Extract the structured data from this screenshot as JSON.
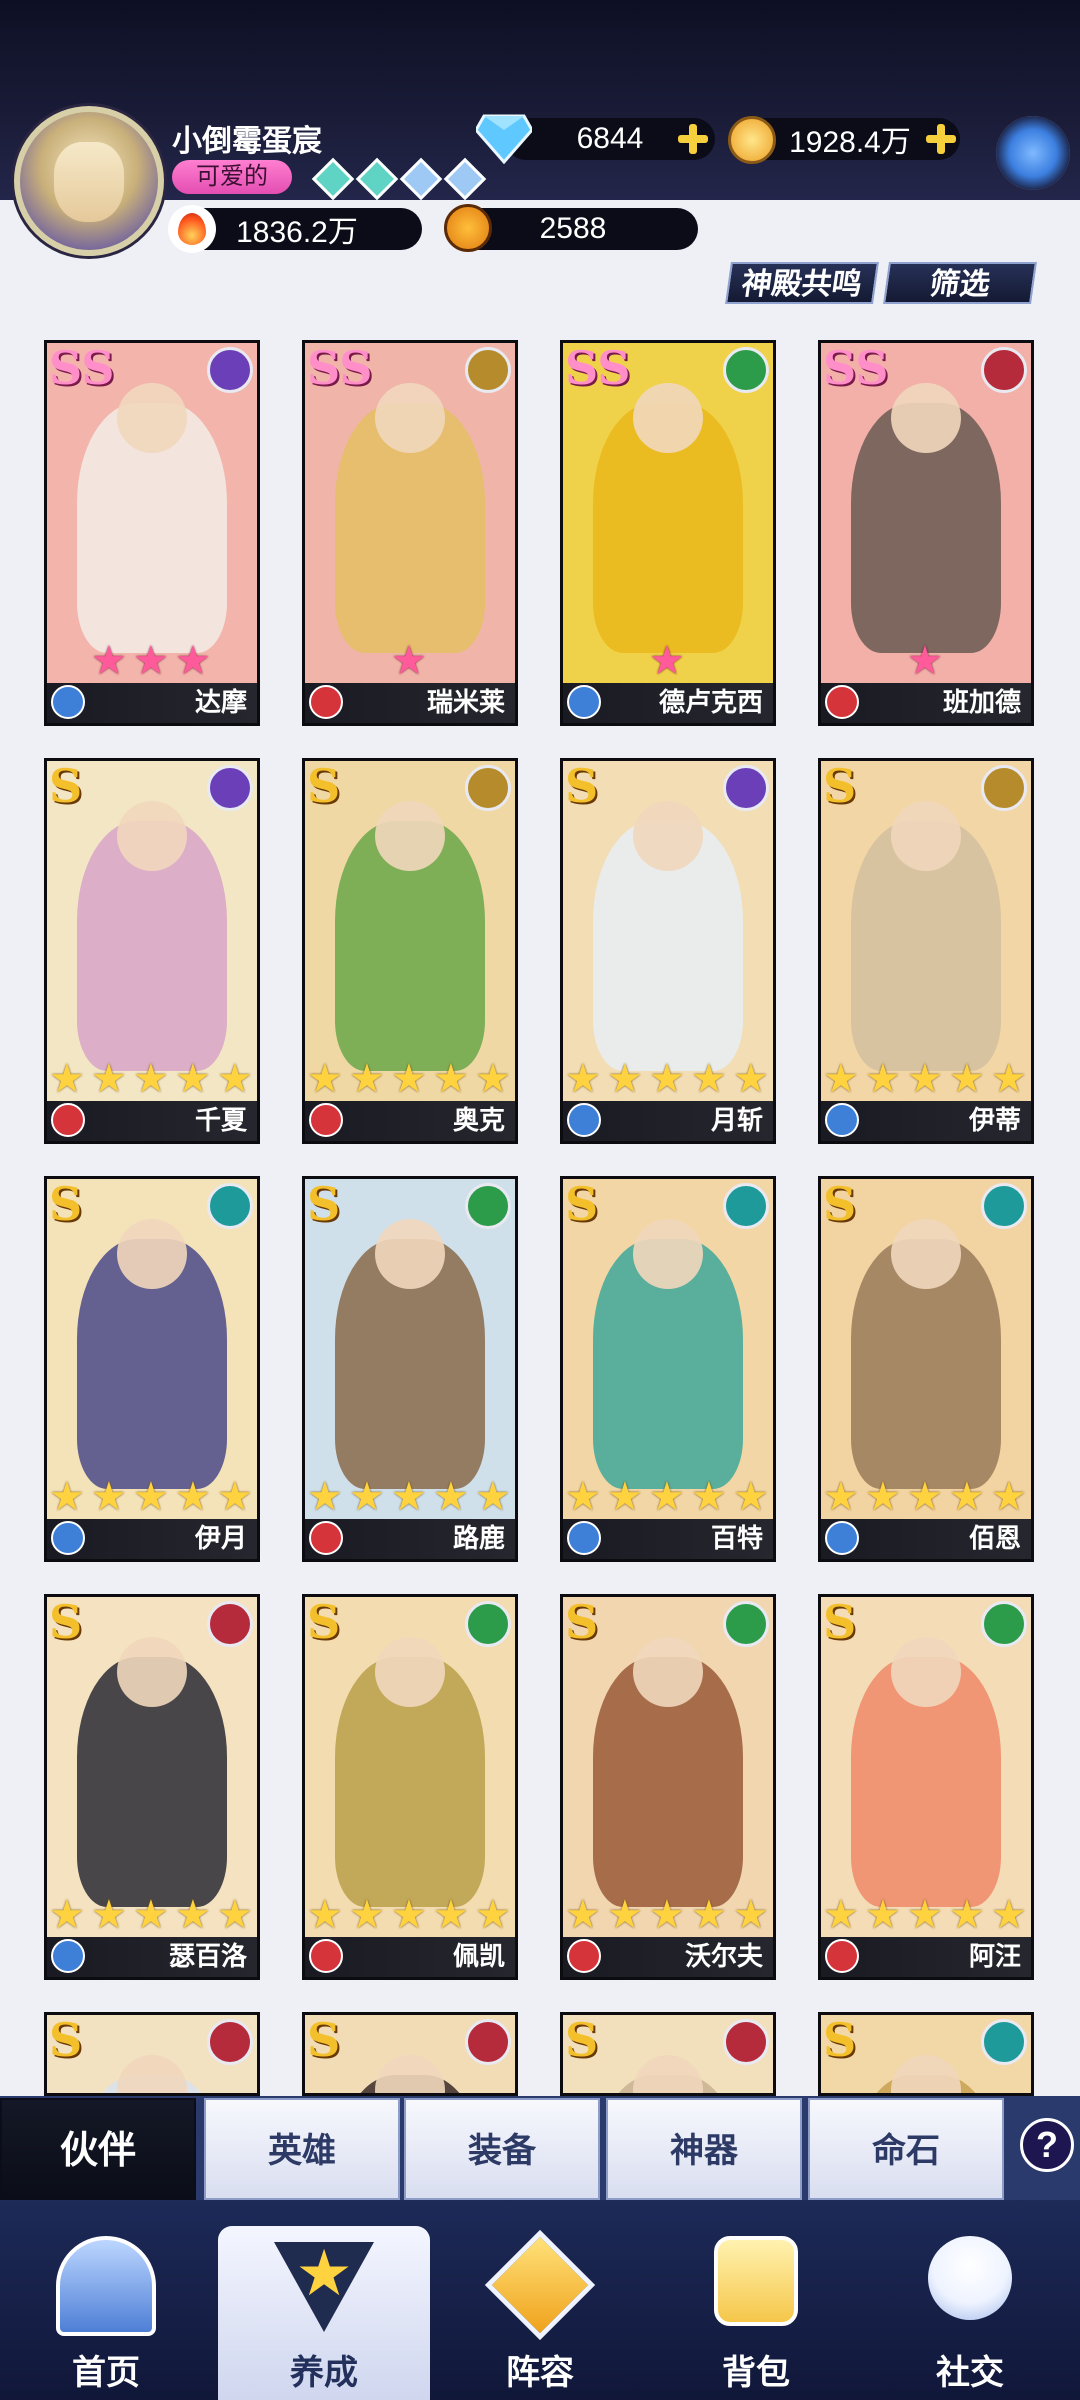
{
  "player": {
    "name": "小倒霉蛋宸",
    "title": "可爱的",
    "diamonds": "6844",
    "gold": "1928.4万",
    "power": "1836.2万",
    "star_coins": "2588"
  },
  "filters": {
    "resonance_label": "神殿共鸣",
    "filter_label": "筛选"
  },
  "cards": [
    {
      "name": "达摩",
      "rank": "SS",
      "stars": 3,
      "star_color": "pink",
      "faction_color": "#6b3fb8",
      "role_color": "#3e7fd8",
      "bg": "#f3b4ab",
      "figure": "#f2ede6"
    },
    {
      "name": "瑞米莱",
      "rank": "SS",
      "stars": 1,
      "star_color": "pink",
      "faction_color": "#b58b2c",
      "role_color": "#d6343b",
      "bg": "#f0b5a8",
      "figure": "#e4c063"
    },
    {
      "name": "德卢克西",
      "rank": "SS",
      "stars": 1,
      "star_color": "pink",
      "faction_color": "#2c9c4a",
      "role_color": "#3e7fd8",
      "bg": "#f0d24a",
      "figure": "#e9b91a"
    },
    {
      "name": "班加德",
      "rank": "SS",
      "stars": 1,
      "star_color": "pink",
      "faction_color": "#b52b3b",
      "role_color": "#d6343b",
      "bg": "#f2b0a8",
      "figure": "#6a5a52"
    },
    {
      "name": "千夏",
      "rank": "S",
      "stars": 5,
      "star_color": "gold",
      "faction_color": "#6b3fb8",
      "role_color": "#d6343b",
      "bg": "#f3e6c4",
      "figure": "#d7a3c8"
    },
    {
      "name": "奥克",
      "rank": "S",
      "stars": 5,
      "star_color": "gold",
      "faction_color": "#b58b2c",
      "role_color": "#d6343b",
      "bg": "#f0d8a4",
      "figure": "#6aa84a"
    },
    {
      "name": "月斩",
      "rank": "S",
      "stars": 5,
      "star_color": "gold",
      "faction_color": "#6b3fb8",
      "role_color": "#3e7fd8",
      "bg": "#f3ddb4",
      "figure": "#e8eef6"
    },
    {
      "name": "伊蒂",
      "rank": "S",
      "stars": 5,
      "star_color": "gold",
      "faction_color": "#b58b2c",
      "role_color": "#3e7fd8",
      "bg": "#f2d6a6",
      "figure": "#d4c0a0"
    },
    {
      "name": "伊月",
      "rank": "S",
      "stars": 5,
      "star_color": "gold",
      "faction_color": "#1f9a9a",
      "role_color": "#3e7fd8",
      "bg": "#f4e2b8",
      "figure": "#4a4a8a"
    },
    {
      "name": "路鹿",
      "rank": "S",
      "stars": 5,
      "star_color": "gold",
      "faction_color": "#2c9c4a",
      "role_color": "#d6343b",
      "bg": "#cfe0ea",
      "figure": "#8a6a4a"
    },
    {
      "name": "百特",
      "rank": "S",
      "stars": 5,
      "star_color": "gold",
      "faction_color": "#1f9a9a",
      "role_color": "#3e7fd8",
      "bg": "#f2d6a6",
      "figure": "#3ea79a"
    },
    {
      "name": "佰恩",
      "rank": "S",
      "stars": 5,
      "star_color": "gold",
      "faction_color": "#1f9a9a",
      "role_color": "#3e7fd8",
      "bg": "#f2d3a2",
      "figure": "#9a7a5a"
    },
    {
      "name": "瑟百洛",
      "rank": "S",
      "stars": 5,
      "star_color": "gold",
      "faction_color": "#b52b3b",
      "role_color": "#3e7fd8",
      "bg": "#f4e2c0",
      "figure": "#2a2a34"
    },
    {
      "name": "佩凯",
      "rank": "S",
      "stars": 5,
      "star_color": "gold",
      "faction_color": "#2c9c4a",
      "role_color": "#d6343b",
      "bg": "#f3dcb0",
      "figure": "#b8a04a"
    },
    {
      "name": "沃尔夫",
      "rank": "S",
      "stars": 5,
      "star_color": "gold",
      "faction_color": "#2c9c4a",
      "role_color": "#d6343b",
      "bg": "#f1d6b0",
      "figure": "#9a5a3a"
    },
    {
      "name": "阿汪",
      "rank": "S",
      "stars": 5,
      "star_color": "gold",
      "faction_color": "#2c9c4a",
      "role_color": "#d6343b",
      "bg": "#f3dcb6",
      "figure": "#f08a6a"
    },
    {
      "name": "",
      "rank": "S",
      "stars": 0,
      "star_color": "gold",
      "faction_color": "#b52b3b",
      "role_color": "#3e7fd8",
      "bg": "#f2e2c2",
      "figure": "#d8e2ee"
    },
    {
      "name": "",
      "rank": "S",
      "stars": 0,
      "star_color": "gold",
      "faction_color": "#b52b3b",
      "role_color": "#3e7fd8",
      "bg": "#f1dcb6",
      "figure": "#3a2a28"
    },
    {
      "name": "",
      "rank": "S",
      "stars": 0,
      "star_color": "gold",
      "faction_color": "#b52b3b",
      "role_color": "#3e7fd8",
      "bg": "#f2e0bc",
      "figure": "#c8b090"
    },
    {
      "name": "",
      "rank": "S",
      "stars": 0,
      "star_color": "gold",
      "faction_color": "#1f9a9a",
      "role_color": "#3e7fd8",
      "bg": "#f2d8a6",
      "figure": "#c8a050"
    }
  ],
  "subtabs": [
    "伙伴",
    "英雄",
    "装备",
    "神器",
    "命石"
  ],
  "help_label": "?",
  "nav": [
    "首页",
    "养成",
    "阵容",
    "背包",
    "社交"
  ],
  "icons": {
    "diamond": "diamond-icon",
    "gold": "gold-coin-icon",
    "power": "flame-icon",
    "star_coin": "star-coin-icon",
    "settings": "gear-icon"
  }
}
